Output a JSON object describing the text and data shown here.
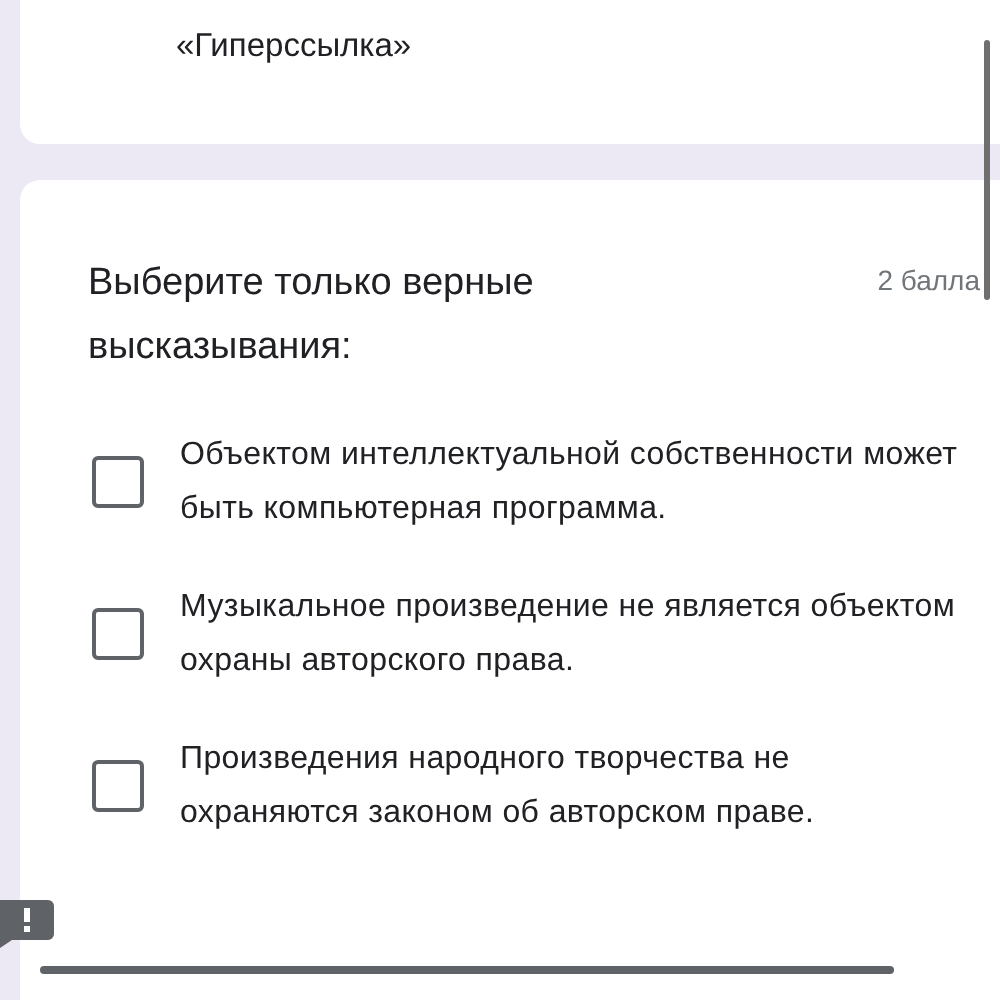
{
  "previous_card": {
    "text": "«Гиперссылка»"
  },
  "question": {
    "title": "Выберите только верные высказывания:",
    "points": "2 балла",
    "options": [
      {
        "text": "Объектом интеллектуальной собственности может быть компьютерная программа.",
        "checked": false
      },
      {
        "text": "Музыкальное произведение не является объектом охраны авторского права.",
        "checked": false
      },
      {
        "text": "Произведения народного творчества не охраняются законом об авторском праве.",
        "checked": false
      }
    ]
  }
}
